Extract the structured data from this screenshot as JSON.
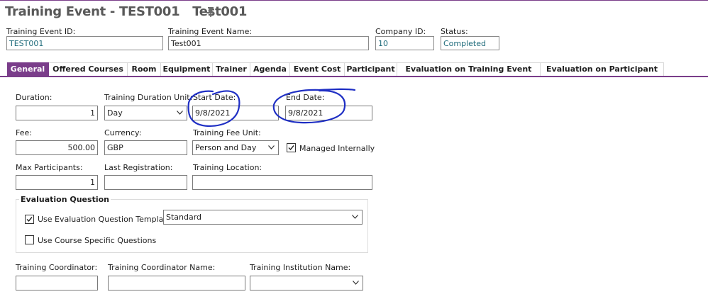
{
  "header": {
    "title": "Training Event - TEST001   Test001",
    "fields": {
      "event_id": {
        "label": "Training Event ID:",
        "value": "TEST001"
      },
      "event_name": {
        "label": "Training Event Name:",
        "value": "Test001"
      },
      "company_id": {
        "label": "Company ID:",
        "value": "10"
      },
      "status": {
        "label": "Status:",
        "value": "Completed"
      }
    }
  },
  "tabs": [
    {
      "label": "General",
      "active": true
    },
    {
      "label": "Offered Courses"
    },
    {
      "label": "Room"
    },
    {
      "label": "Equipment"
    },
    {
      "label": "Trainer"
    },
    {
      "label": "Agenda"
    },
    {
      "label": "Event Cost"
    },
    {
      "label": "Participant"
    },
    {
      "label": "Evaluation on Training Event"
    },
    {
      "label": "Evaluation on Participant"
    }
  ],
  "general": {
    "duration": {
      "label": "Duration:",
      "value": "1"
    },
    "duration_unit": {
      "label": "Training Duration Unit:",
      "value": "Day"
    },
    "start_date": {
      "label": "Start Date:",
      "value": "9/8/2021"
    },
    "end_date": {
      "label": "End Date:",
      "value": "9/8/2021"
    },
    "fee": {
      "label": "Fee:",
      "value": "500.00"
    },
    "currency": {
      "label": "Currency:",
      "value": "GBP"
    },
    "fee_unit": {
      "label": "Training Fee Unit:",
      "value": "Person and Day"
    },
    "managed_internally": {
      "label": "Managed Internally",
      "checked": true
    },
    "max_participants": {
      "label": "Max Participants:",
      "value": "1"
    },
    "last_registration": {
      "label": "Last Registration:",
      "value": ""
    },
    "training_location": {
      "label": "Training Location:",
      "value": ""
    },
    "evaluation": {
      "title": "Evaluation Question",
      "use_template": {
        "label": "Use Evaluation Question Template",
        "checked": true
      },
      "template": {
        "value": "Standard"
      },
      "use_course_specific": {
        "label": "Use Course Specific Questions",
        "checked": false
      }
    },
    "coordinator": {
      "label": "Training Coordinator:",
      "value": ""
    },
    "coordinator_name": {
      "label": "Training Coordinator Name:",
      "value": ""
    },
    "institution_name": {
      "label": "Training Institution Name:",
      "value": ""
    }
  },
  "colors": {
    "accent": "#7a3d8a",
    "annotation": "#1f2fc4",
    "value_text": "#1d6a7a"
  },
  "icons": {
    "pin": "pin-icon",
    "dropdown": "chevron-down-icon",
    "checkbox": "checkmark-icon"
  }
}
